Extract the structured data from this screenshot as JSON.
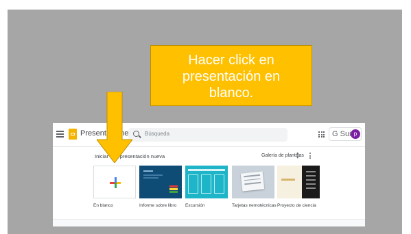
{
  "callout": {
    "line1": "Hacer click en",
    "line2": "presentación en",
    "line3": "blanco."
  },
  "topbar": {
    "app_title": "Presentaciones",
    "search_placeholder": "Búsqueda",
    "gsuite_label": "G Suite",
    "avatar_initial": "p"
  },
  "section": {
    "title": "Iniciar una presentación nueva",
    "gallery_label": "Galería de plantillas"
  },
  "templates": [
    {
      "label": "En blanco",
      "icon": "plus-icon"
    },
    {
      "label": "Informe sobre libro"
    },
    {
      "label": "Excursión"
    },
    {
      "label": "Tarjetas nemotécnicas"
    },
    {
      "label": "Proyecto de ciencia"
    }
  ],
  "colors": {
    "background": "#a6a6a6",
    "callout": "#ffc000",
    "avatar": "#7b1fa2",
    "app_icon": "#f4b400"
  }
}
